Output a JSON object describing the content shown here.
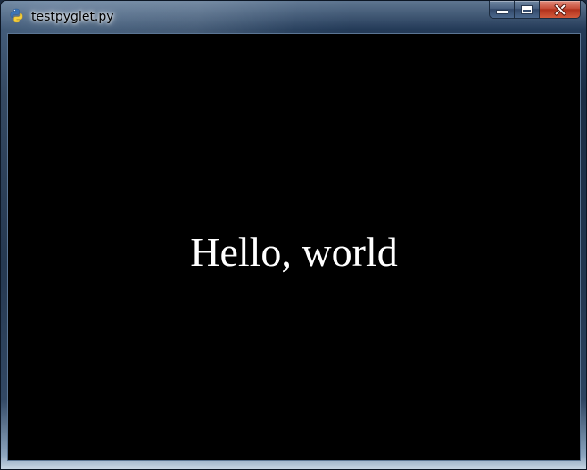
{
  "window": {
    "title": "testpyglet.py",
    "app_icon": "python-icon",
    "controls": {
      "minimize_icon": "minimize-icon",
      "maximize_icon": "maximize-icon",
      "close_icon": "close-icon"
    }
  },
  "canvas": {
    "background_color": "#000000",
    "text": "Hello, world",
    "text_color": "#ffffff"
  },
  "colors": {
    "close_button": "#c8503b",
    "frame": "#1a2c44"
  }
}
